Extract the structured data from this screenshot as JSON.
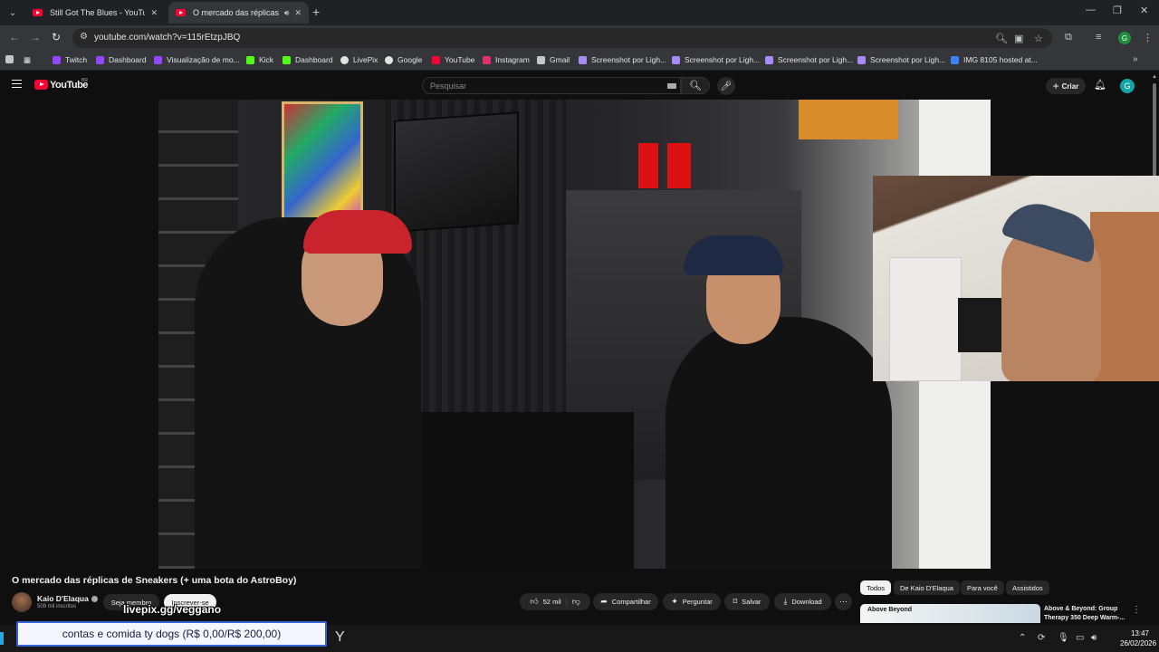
{
  "browser": {
    "tabs": [
      {
        "title": "Still Got The Blues - YouTube",
        "active": false
      },
      {
        "title": "O mercado das réplicas de",
        "active": true
      }
    ],
    "url": "youtube.com/watch?v=115rEtzpJBQ",
    "profile_letter": "G",
    "bookmarks": [
      {
        "label": "Twitch",
        "color": "#9146ff"
      },
      {
        "label": "Dashboard",
        "color": "#9146ff"
      },
      {
        "label": "Visualização de mo...",
        "color": "#9146ff"
      },
      {
        "label": "Kick",
        "color": "#53fc18"
      },
      {
        "label": "Dashboard",
        "color": "#53fc18"
      },
      {
        "label": "LivePix",
        "color": "#e3e3e3"
      },
      {
        "label": "Google",
        "color": "#e3e3e3"
      },
      {
        "label": "YouTube",
        "color": "#ff0033"
      },
      {
        "label": "Instagram",
        "color": "#e1306c"
      },
      {
        "label": "Gmail",
        "color": "#c4c7c5"
      },
      {
        "label": "Screenshot por Ligh...",
        "color": "#a78bfa"
      },
      {
        "label": "Screenshot por Ligh...",
        "color": "#a78bfa"
      },
      {
        "label": "Screenshot por Ligh...",
        "color": "#a78bfa"
      },
      {
        "label": "Screenshot por Ligh...",
        "color": "#a78bfa"
      },
      {
        "label": "IMG 8105 hosted at...",
        "color": "#3b82f6"
      }
    ]
  },
  "youtube": {
    "logo_text": "YouTube",
    "country_code": "BR",
    "search_placeholder": "Pesquisar",
    "create_label": "Criar",
    "avatar_letter": "G"
  },
  "video": {
    "title": "O mercado das réplicas de Sneakers (+ uma bota do AstroBoy)",
    "channel": {
      "name": "Kaio D'Elaqua",
      "subscribers": "509 mil inscritos",
      "member_label": "Seja membro",
      "subscribe_label": "Inscrever-se"
    },
    "actions": {
      "likes": "52 mil",
      "share": "Compartilhar",
      "ask": "Perguntar",
      "save": "Salvar",
      "download": "Download"
    }
  },
  "recommendations": {
    "chips": [
      "Todos",
      "De Kaio D'Elaqua",
      "Para você",
      "Assistidos"
    ],
    "items": [
      {
        "title": "Above & Beyond: Group Therapy 350 Deep Warm-...",
        "thumb_text": "Above Beyond"
      }
    ]
  },
  "overlays": {
    "livepix": "livepix.gg/veggano",
    "goal": "contas e comida ty dogs (R$ 0,00/R$ 200,00)"
  },
  "taskbar": {
    "time": "13:47",
    "date": "26/02/2026"
  }
}
